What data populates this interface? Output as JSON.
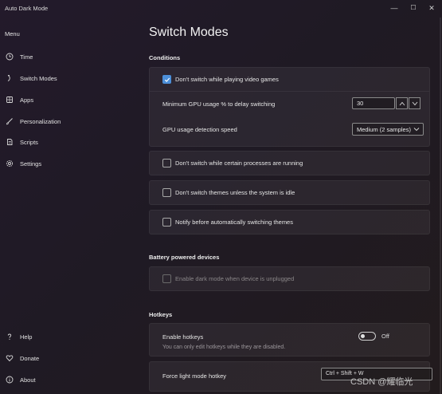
{
  "window": {
    "title": "Auto Dark Mode",
    "minimize": "—",
    "maximize": "☐",
    "close": "✕"
  },
  "sidebar": {
    "header": "Menu",
    "items": [
      {
        "label": "Time",
        "icon": "clock-icon"
      },
      {
        "label": "Switch Modes",
        "icon": "switch-icon"
      },
      {
        "label": "Apps",
        "icon": "apps-icon"
      },
      {
        "label": "Personalization",
        "icon": "brush-icon"
      },
      {
        "label": "Scripts",
        "icon": "script-icon"
      },
      {
        "label": "Settings",
        "icon": "gear-icon"
      }
    ],
    "footer": [
      {
        "label": "Help",
        "icon": "help-icon"
      },
      {
        "label": "Donate",
        "icon": "heart-icon"
      },
      {
        "label": "About",
        "icon": "info-icon"
      }
    ]
  },
  "main": {
    "title": "Switch Modes",
    "conditions": {
      "label": "Conditions",
      "games": {
        "label": "Don't switch while playing video games",
        "checked": true
      },
      "gpu_threshold": {
        "label": "Minimum GPU usage % to delay switching",
        "value": "30"
      },
      "gpu_speed": {
        "label": "GPU usage detection speed",
        "value": "Medium (2 samples)"
      },
      "processes": {
        "label": "Don't switch while certain processes are running",
        "checked": false
      },
      "idle": {
        "label": "Don't switch themes unless the system is idle",
        "checked": false
      },
      "notify": {
        "label": "Notify before automatically switching themes",
        "checked": false
      }
    },
    "battery": {
      "label": "Battery powered devices",
      "unplugged": {
        "label": "Enable dark mode when device is unplugged",
        "checked": false
      }
    },
    "hotkeys": {
      "label": "Hotkeys",
      "enable": {
        "label": "Enable hotkeys",
        "state": "Off",
        "note": "You can only edit hotkeys while they are disabled."
      },
      "force_light": {
        "label": "Force light mode hotkey",
        "value": "Ctrl + Shift + W"
      }
    }
  },
  "watermark": "CSDN @耀临光",
  "colors": {
    "accent": "#4c8fd9",
    "card": "#2b2530"
  }
}
